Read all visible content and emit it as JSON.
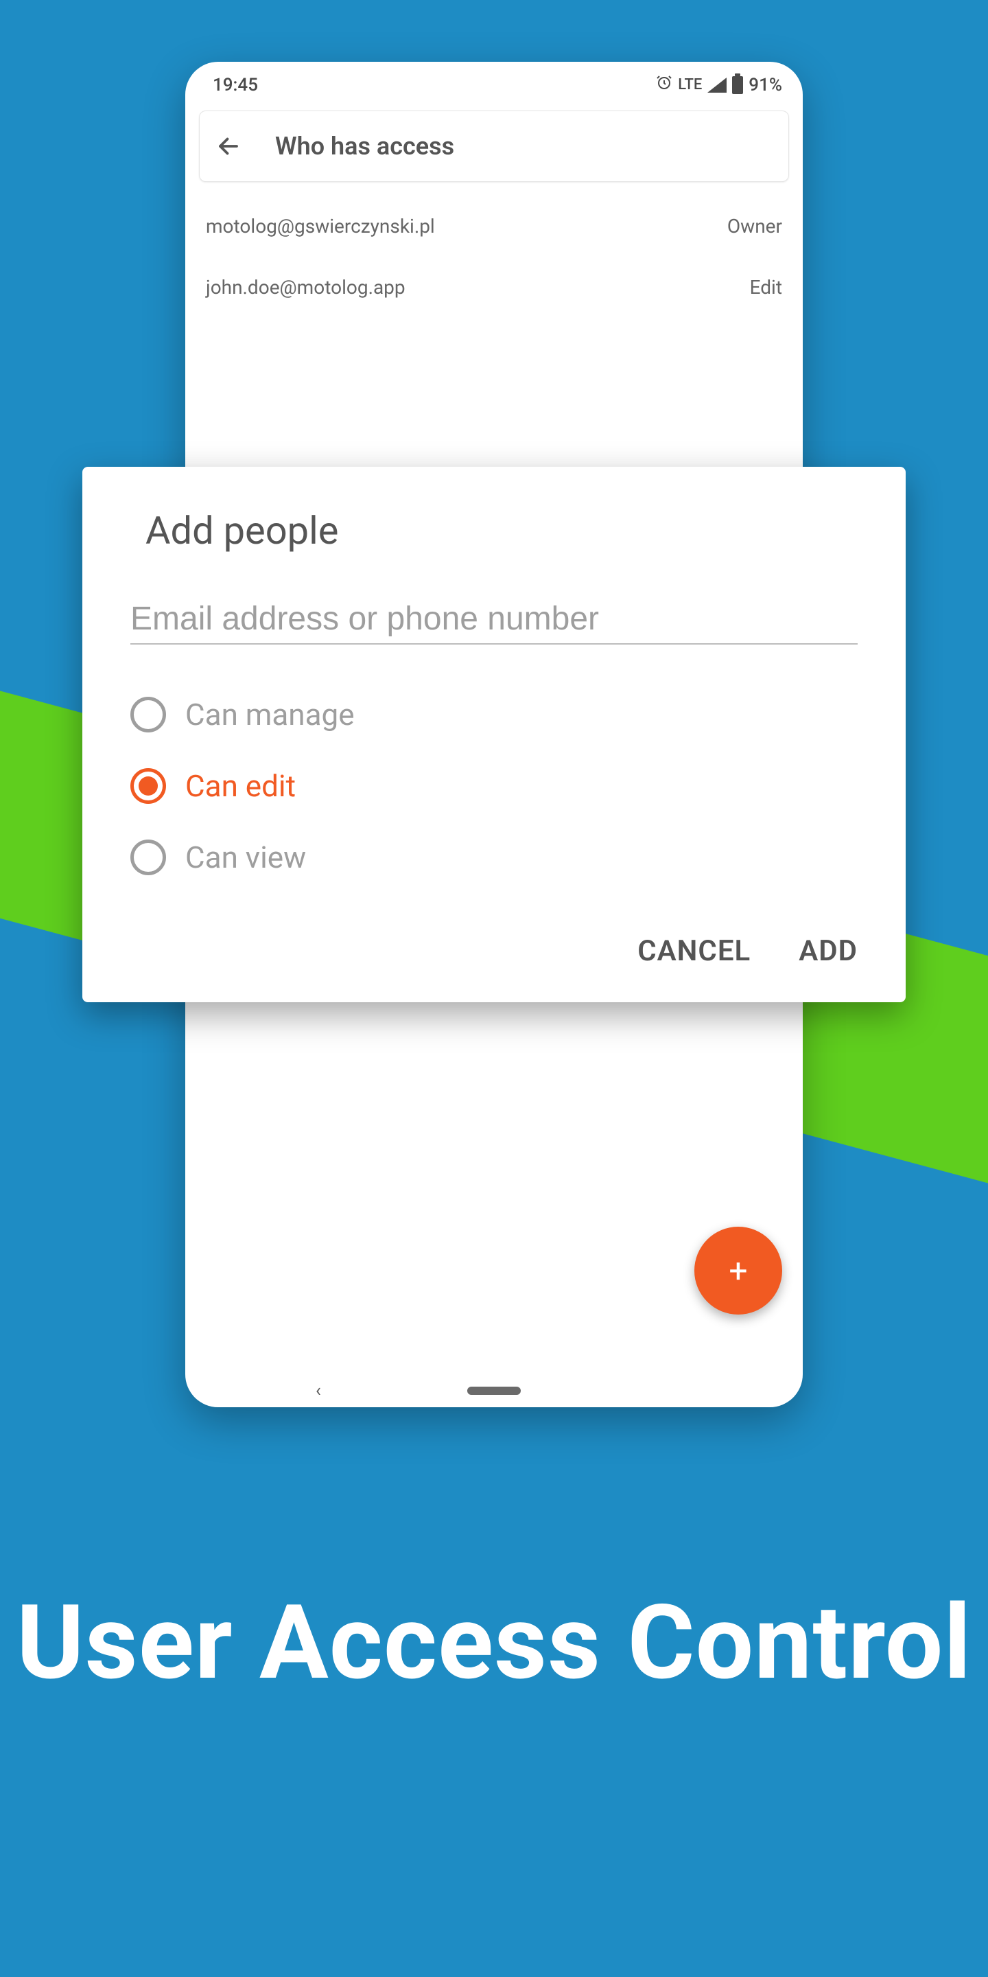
{
  "status_bar": {
    "time": "19:45",
    "network": "LTE",
    "battery": "91%"
  },
  "header": {
    "title": "Who has access"
  },
  "access_list": [
    {
      "email": "motolog@gswierczynski.pl",
      "role": "Owner"
    },
    {
      "email": "john.doe@motolog.app",
      "role": "Edit"
    }
  ],
  "dialog": {
    "title": "Add people",
    "input_placeholder": "Email address or phone number",
    "options": [
      {
        "label": "Can manage",
        "selected": false
      },
      {
        "label": "Can edit",
        "selected": true
      },
      {
        "label": "Can view",
        "selected": false
      }
    ],
    "cancel_label": "CANCEL",
    "add_label": "ADD"
  },
  "caption": "User Access Control",
  "colors": {
    "background": "#1e8cc4",
    "accent_green": "#5fce1e",
    "accent_orange": "#f15a22"
  }
}
